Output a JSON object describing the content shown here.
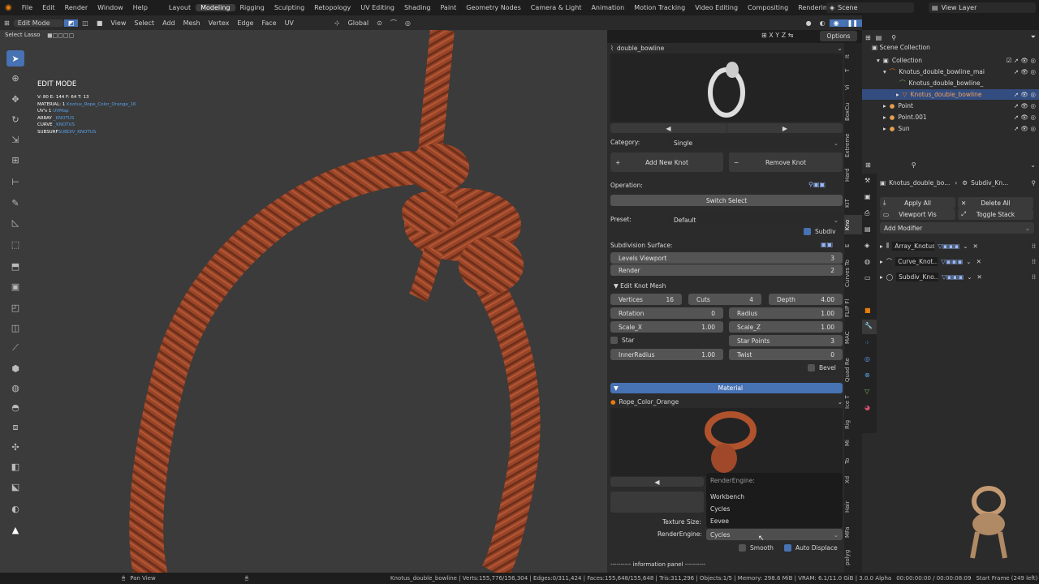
{
  "topbar": {
    "menus": [
      "File",
      "Edit",
      "Render",
      "Window",
      "Help"
    ],
    "workspaces": [
      "Layout",
      "Modeling",
      "Rigging",
      "Sculpting",
      "Retopology",
      "UV Editing",
      "Shading",
      "Paint",
      "Geometry Nodes",
      "Camera & Light",
      "Animation",
      "Motion Tracking",
      "Video Editing",
      "Compositing",
      "Rendering"
    ],
    "active_workspace": "Modeling",
    "scene": "Scene",
    "view_layer": "View Layer"
  },
  "viewport_header": {
    "mode": "Edit Mode",
    "menus": [
      "View",
      "Select",
      "Add",
      "Mesh",
      "Vertex",
      "Edge",
      "Face",
      "UV"
    ],
    "orientation": "Global",
    "options": "Options",
    "select_tool": "Select Lasso"
  },
  "overlay": {
    "mode_title": "EDIT MODE",
    "stats_v": "V: 80",
    "stats_e": "E: 144",
    "stats_f": "F: 64",
    "stats_t": "T: 13",
    "material_label": "MATERIAL: 1",
    "material_value": "Knotus_Rope_Color_Orange_1K",
    "uvs_label": "UV's 1",
    "uvs_value": "UVMap",
    "array_label": "ARRAY",
    "array_value": "_KNOTUS",
    "curve_label": "CURVE",
    "curve_value": "_KNOTUS",
    "subsurf_label": "SUBSURF",
    "subsurf_value": "SUBDIV_KNOTUS"
  },
  "knot_panel": {
    "knot_name": "double_bowline",
    "category_label": "Category:",
    "category_value": "Single",
    "add_knot": "Add New Knot",
    "remove_knot": "Remove Knot",
    "operation_label": "Operation:",
    "switch_select": "Switch Select",
    "preset_label": "Preset:",
    "preset_value": "Default",
    "subdiv_label": "Subdiv",
    "subdiv_surface_label": "Subdivision Surface:",
    "levels_viewport_label": "Levels Viewport",
    "levels_viewport_value": "3",
    "render_label": "Render",
    "render_value": "2",
    "edit_knot_mesh": "Edit Knot Mesh",
    "vertices_label": "Vertices",
    "vertices_value": "16",
    "cuts_label": "Cuts",
    "cuts_value": "4",
    "depth_label": "Depth",
    "depth_value": "4.00",
    "rotation_label": "Rotation",
    "rotation_value": "0",
    "radius_label": "Radius",
    "radius_value": "1.00",
    "scalex_label": "Scale_X",
    "scalex_value": "1.00",
    "scalez_label": "Scale_Z",
    "scalez_value": "1.00",
    "star_label": "Star",
    "star_points_label": "Star Points",
    "star_points_value": "3",
    "inner_radius_label": "InnerRadius",
    "inner_radius_value": "1.00",
    "twist_label": "Twist",
    "twist_value": "0",
    "bevel_label": "Bevel",
    "material_header": "Material",
    "material_name": "Rope_Color_Orange",
    "texture_size_label": "Texture Size:",
    "render_engine_label": "RenderEngine:",
    "render_engine_value": "Cycles",
    "smooth_label": "Smooth",
    "auto_displace_label": "Auto Displace",
    "info_panel": "---------- information panel ----------"
  },
  "render_popup": {
    "title": "RenderEngine:",
    "options": [
      "Workbench",
      "Cycles",
      "Eevee"
    ]
  },
  "vertical_tabs": [
    "It",
    "T",
    "Vi",
    "BoxCu",
    "Extreme",
    "Hard",
    "KIT",
    "Kno",
    "E",
    "Curves To",
    "FLIP Fl",
    "MAC",
    "Quad Re",
    "Ice T",
    "Rig",
    "Mi",
    "To",
    "Xd",
    "Hair",
    "MFa",
    "polyg"
  ],
  "outliner": {
    "scene_collection": "Scene Collection",
    "items": [
      {
        "label": "Collection"
      },
      {
        "label": "Knotus_double_bowline_mai"
      },
      {
        "label": "Knotus_double_bowline_"
      },
      {
        "label": "Knotus_double_bowline"
      },
      {
        "label": "Point"
      },
      {
        "label": "Point.001"
      },
      {
        "label": "Sun"
      }
    ]
  },
  "properties": {
    "object_name": "Knotus_double_bo...",
    "modifier_name": "Subdiv_Kn...",
    "apply_all": "Apply All",
    "delete_all": "Delete All",
    "viewport_vis": "Viewport Vis",
    "toggle_stack": "Toggle Stack",
    "add_modifier": "Add Modifier",
    "modifiers": [
      "Array_Knotus",
      "Curve_Knot...",
      "Subdiv_Kno..."
    ]
  },
  "status": {
    "pan": "Pan View",
    "info": "Knotus_double_bowline | Verts:155,776/156,304 | Edges:0/311,424 | Faces:155,648/155,648 | Tris:311,296 | Objects:1/5 | Memory: 298.6 MiB | VRAM: 6.1/11.0 GiB | 3.0.0 Alpha",
    "time": "00:00:00:00 / 00:00:08:09",
    "frame": "Start Frame (249 left)"
  },
  "colors": {
    "accent": "#4772b3",
    "rope": "#a0482a",
    "viewport": "#3b3b3b",
    "panel": "#2b2b2b",
    "link": "#5aa0e8"
  }
}
